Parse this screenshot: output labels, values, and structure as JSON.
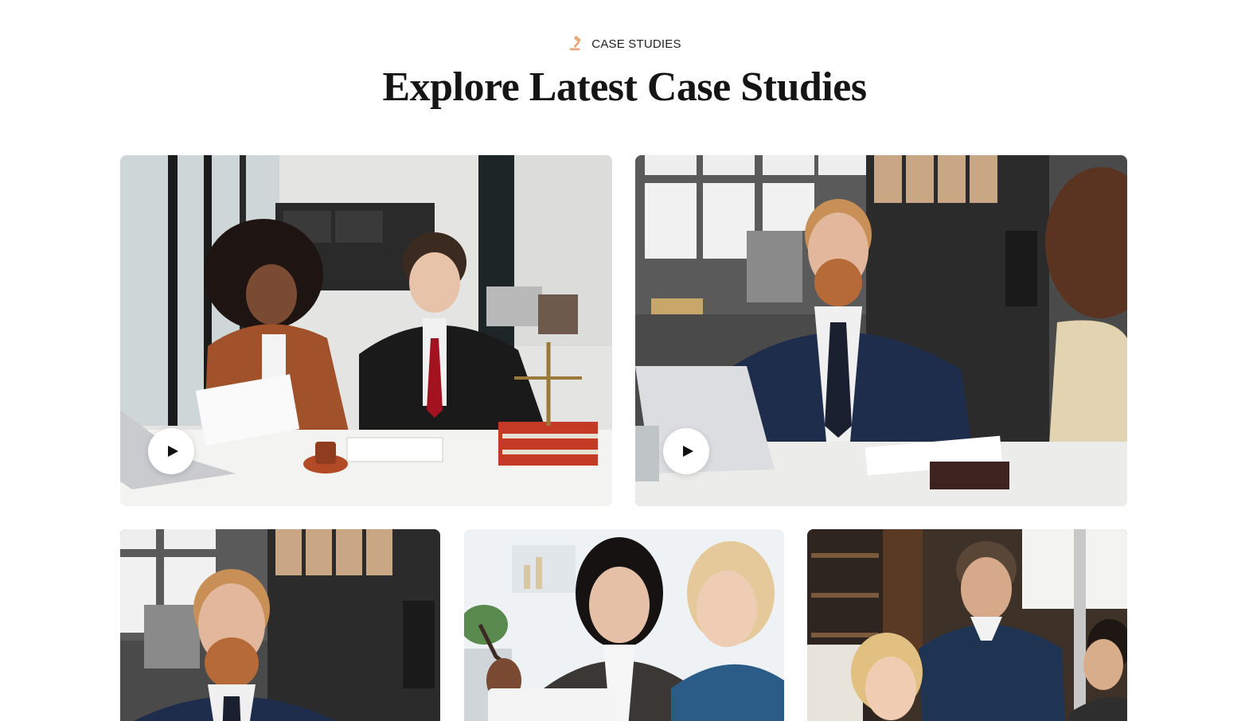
{
  "section": {
    "eyebrow_icon": "gavel-icon",
    "eyebrow_label": "CASE STUDIES",
    "title": "Explore Latest Case Studies",
    "accent_color": "#e8a878"
  },
  "cards": [
    {
      "image": "two lawyers signing documents at a desk with a gavel and scales",
      "has_play_button": true,
      "play_icon": "play-icon"
    },
    {
      "image": "lawyer with glasses reviewing documents across a desk with a client",
      "has_play_button": true,
      "play_icon": "play-icon"
    },
    {
      "image": "lawyer with glasses at a desk in an office",
      "has_play_button": false
    },
    {
      "image": "two women smiling during a meeting at a laptop",
      "has_play_button": false
    },
    {
      "image": "man in sweater advising two colleagues at a table",
      "has_play_button": false
    }
  ]
}
